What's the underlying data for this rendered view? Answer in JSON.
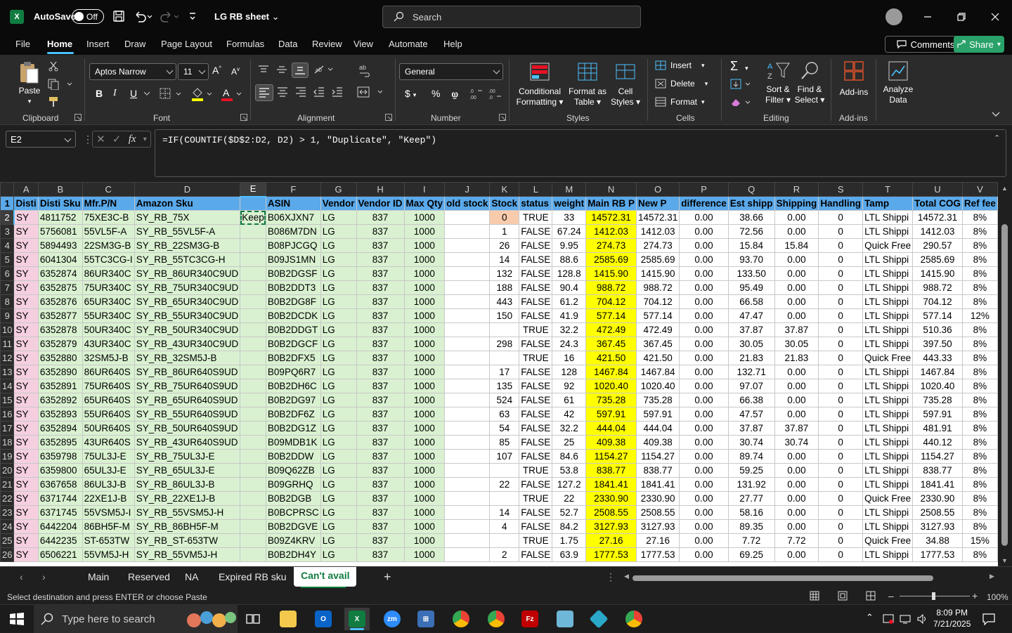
{
  "titlebar": {
    "autosave_label": "AutoSave",
    "toggle_state": "Off",
    "doc_title": "LG RB sheet",
    "search_placeholder": "Search"
  },
  "menu": {
    "items": [
      "File",
      "Home",
      "Insert",
      "Draw",
      "Page Layout",
      "Formulas",
      "Data",
      "Review",
      "View",
      "Automate",
      "Help"
    ],
    "active": "Home",
    "comments": "Comments",
    "share": "Share"
  },
  "ribbon": {
    "clipboard": {
      "label": "Clipboard",
      "paste": "Paste"
    },
    "font": {
      "label": "Font",
      "name": "Aptos Narrow",
      "size": "11",
      "bold": "B",
      "italic": "I",
      "underline": "U"
    },
    "alignment": {
      "label": "Alignment"
    },
    "number": {
      "label": "Number",
      "format": "General"
    },
    "styles": {
      "label": "Styles",
      "conditional": [
        "Conditional",
        "Formatting"
      ],
      "format_table": [
        "Format as",
        "Table"
      ],
      "cell_styles": [
        "Cell",
        "Styles"
      ]
    },
    "cells": {
      "label": "Cells",
      "insert": "Insert",
      "delete": "Delete",
      "format": "Format"
    },
    "editing": {
      "label": "Editing",
      "sort": [
        "Sort &",
        "Filter"
      ],
      "find": [
        "Find &",
        "Select"
      ]
    },
    "addins": {
      "label": "Add-ins",
      "addins": "Add-ins",
      "analyze": [
        "Analyze",
        "Data"
      ]
    }
  },
  "formula_bar": {
    "name_box": "E2",
    "formula": "=IF(COUNTIF($D$2:D2, D2) > 1, \"Duplicate\", \"Keep\")"
  },
  "columns": [
    "A",
    "B",
    "C",
    "D",
    "E",
    "F",
    "G",
    "H",
    "I",
    "J",
    "K",
    "L",
    "M",
    "N",
    "O",
    "P",
    "Q",
    "R",
    "S",
    "T",
    "U",
    "V"
  ],
  "header_row": [
    "Disti",
    "Disti Sku",
    "Mfr.P/N",
    "Amazon Sku",
    "",
    "ASIN",
    "Vendor",
    "Vendor ID",
    "Max Qty",
    "old stock",
    "Stock",
    "status",
    "weight",
    "Main RB P",
    "New P",
    "difference",
    "Est shipp",
    "Shipping",
    "Handling",
    "Tamp",
    "Total COG",
    "Ref fee"
  ],
  "rows": [
    [
      "SY",
      "4811752",
      "75XE3C-B",
      "SY_RB_75X",
      "Keep",
      "B06XJXN7",
      "LG",
      "837",
      "1000",
      "",
      "0",
      "TRUE",
      "33",
      "14572.31",
      "14572.31",
      "0.00",
      "38.66",
      "0.00",
      "0",
      "LTL Shippi",
      "14572.31",
      "8%"
    ],
    [
      "SY",
      "5756081",
      "55VL5F-A",
      "SY_RB_55VL5F-A",
      "",
      "B086M7DN",
      "LG",
      "837",
      "1000",
      "",
      "1",
      "FALSE",
      "67.24",
      "1412.03",
      "1412.03",
      "0.00",
      "72.56",
      "0.00",
      "0",
      "LTL Shippi",
      "1412.03",
      "8%"
    ],
    [
      "SY",
      "5894493",
      "22SM3G-B",
      "SY_RB_22SM3G-B",
      "",
      "B08PJCGQ",
      "LG",
      "837",
      "1000",
      "",
      "26",
      "FALSE",
      "9.95",
      "274.73",
      "274.73",
      "0.00",
      "15.84",
      "15.84",
      "0",
      "Quick Free",
      "290.57",
      "8%"
    ],
    [
      "SY",
      "6041304",
      "55TC3CG-I",
      "SY_RB_55TC3CG-H",
      "",
      "B09JS1MN",
      "LG",
      "837",
      "1000",
      "",
      "14",
      "FALSE",
      "88.6",
      "2585.69",
      "2585.69",
      "0.00",
      "93.70",
      "0.00",
      "0",
      "LTL Shippi",
      "2585.69",
      "8%"
    ],
    [
      "SY",
      "6352874",
      "86UR340C",
      "SY_RB_86UR340C9UD",
      "",
      "B0B2DGSF",
      "LG",
      "837",
      "1000",
      "",
      "132",
      "FALSE",
      "128.8",
      "1415.90",
      "1415.90",
      "0.00",
      "133.50",
      "0.00",
      "0",
      "LTL Shippi",
      "1415.90",
      "8%"
    ],
    [
      "SY",
      "6352875",
      "75UR340C",
      "SY_RB_75UR340C9UD",
      "",
      "B0B2DDT3",
      "LG",
      "837",
      "1000",
      "",
      "188",
      "FALSE",
      "90.4",
      "988.72",
      "988.72",
      "0.00",
      "95.49",
      "0.00",
      "0",
      "LTL Shippi",
      "988.72",
      "8%"
    ],
    [
      "SY",
      "6352876",
      "65UR340C",
      "SY_RB_65UR340C9UD",
      "",
      "B0B2DG8F",
      "LG",
      "837",
      "1000",
      "",
      "443",
      "FALSE",
      "61.2",
      "704.12",
      "704.12",
      "0.00",
      "66.58",
      "0.00",
      "0",
      "LTL Shippi",
      "704.12",
      "8%"
    ],
    [
      "SY",
      "6352877",
      "55UR340C",
      "SY_RB_55UR340C9UD",
      "",
      "B0B2DCDK",
      "LG",
      "837",
      "1000",
      "",
      "150",
      "FALSE",
      "41.9",
      "577.14",
      "577.14",
      "0.00",
      "47.47",
      "0.00",
      "0",
      "LTL Shippi",
      "577.14",
      "12%"
    ],
    [
      "SY",
      "6352878",
      "50UR340C",
      "SY_RB_50UR340C9UD",
      "",
      "B0B2DDGT",
      "LG",
      "837",
      "1000",
      "",
      "",
      "TRUE",
      "32.2",
      "472.49",
      "472.49",
      "0.00",
      "37.87",
      "37.87",
      "0",
      "LTL Shippi",
      "510.36",
      "8%"
    ],
    [
      "SY",
      "6352879",
      "43UR340C",
      "SY_RB_43UR340C9UD",
      "",
      "B0B2DGCF",
      "LG",
      "837",
      "1000",
      "",
      "298",
      "FALSE",
      "24.3",
      "367.45",
      "367.45",
      "0.00",
      "30.05",
      "30.05",
      "0",
      "LTL Shippi",
      "397.50",
      "8%"
    ],
    [
      "SY",
      "6352880",
      "32SM5J-B",
      "SY_RB_32SM5J-B",
      "",
      "B0B2DFX5",
      "LG",
      "837",
      "1000",
      "",
      "",
      "TRUE",
      "16",
      "421.50",
      "421.50",
      "0.00",
      "21.83",
      "21.83",
      "0",
      "Quick Free",
      "443.33",
      "8%"
    ],
    [
      "SY",
      "6352890",
      "86UR640S",
      "SY_RB_86UR640S9UD",
      "",
      "B09PQ6R7",
      "LG",
      "837",
      "1000",
      "",
      "17",
      "FALSE",
      "128",
      "1467.84",
      "1467.84",
      "0.00",
      "132.71",
      "0.00",
      "0",
      "LTL Shippi",
      "1467.84",
      "8%"
    ],
    [
      "SY",
      "6352891",
      "75UR640S",
      "SY_RB_75UR640S9UD",
      "",
      "B0B2DH6C",
      "LG",
      "837",
      "1000",
      "",
      "135",
      "FALSE",
      "92",
      "1020.40",
      "1020.40",
      "0.00",
      "97.07",
      "0.00",
      "0",
      "LTL Shippi",
      "1020.40",
      "8%"
    ],
    [
      "SY",
      "6352892",
      "65UR640S",
      "SY_RB_65UR640S9UD",
      "",
      "B0B2DG97",
      "LG",
      "837",
      "1000",
      "",
      "524",
      "FALSE",
      "61",
      "735.28",
      "735.28",
      "0.00",
      "66.38",
      "0.00",
      "0",
      "LTL Shippi",
      "735.28",
      "8%"
    ],
    [
      "SY",
      "6352893",
      "55UR640S",
      "SY_RB_55UR640S9UD",
      "",
      "B0B2DF6Z",
      "LG",
      "837",
      "1000",
      "",
      "63",
      "FALSE",
      "42",
      "597.91",
      "597.91",
      "0.00",
      "47.57",
      "0.00",
      "0",
      "LTL Shippi",
      "597.91",
      "8%"
    ],
    [
      "SY",
      "6352894",
      "50UR640S",
      "SY_RB_50UR640S9UD",
      "",
      "B0B2DG1Z",
      "LG",
      "837",
      "1000",
      "",
      "54",
      "FALSE",
      "32.2",
      "444.04",
      "444.04",
      "0.00",
      "37.87",
      "37.87",
      "0",
      "LTL Shippi",
      "481.91",
      "8%"
    ],
    [
      "SY",
      "6352895",
      "43UR640S",
      "SY_RB_43UR640S9UD",
      "",
      "B09MDB1K",
      "LG",
      "837",
      "1000",
      "",
      "85",
      "FALSE",
      "25",
      "409.38",
      "409.38",
      "0.00",
      "30.74",
      "30.74",
      "0",
      "LTL Shippi",
      "440.12",
      "8%"
    ],
    [
      "SY",
      "6359798",
      "75UL3J-E",
      "SY_RB_75UL3J-E",
      "",
      "B0B2DDW",
      "LG",
      "837",
      "1000",
      "",
      "107",
      "FALSE",
      "84.6",
      "1154.27",
      "1154.27",
      "0.00",
      "89.74",
      "0.00",
      "0",
      "LTL Shippi",
      "1154.27",
      "8%"
    ],
    [
      "SY",
      "6359800",
      "65UL3J-E",
      "SY_RB_65UL3J-E",
      "",
      "B09Q62ZB",
      "LG",
      "837",
      "1000",
      "",
      "",
      "TRUE",
      "53.8",
      "838.77",
      "838.77",
      "0.00",
      "59.25",
      "0.00",
      "0",
      "LTL Shippi",
      "838.77",
      "8%"
    ],
    [
      "SY",
      "6367658",
      "86UL3J-B",
      "SY_RB_86UL3J-B",
      "",
      "B09GRHQ",
      "LG",
      "837",
      "1000",
      "",
      "22",
      "FALSE",
      "127.2",
      "1841.41",
      "1841.41",
      "0.00",
      "131.92",
      "0.00",
      "0",
      "LTL Shippi",
      "1841.41",
      "8%"
    ],
    [
      "SY",
      "6371744",
      "22XE1J-B",
      "SY_RB_22XE1J-B",
      "",
      "B0B2DGB",
      "LG",
      "837",
      "1000",
      "",
      "",
      "TRUE",
      "22",
      "2330.90",
      "2330.90",
      "0.00",
      "27.77",
      "0.00",
      "0",
      "Quick Free",
      "2330.90",
      "8%"
    ],
    [
      "SY",
      "6371745",
      "55VSM5J-I",
      "SY_RB_55VSM5J-H",
      "",
      "B0BCPRSC",
      "LG",
      "837",
      "1000",
      "",
      "14",
      "FALSE",
      "52.7",
      "2508.55",
      "2508.55",
      "0.00",
      "58.16",
      "0.00",
      "0",
      "LTL Shippi",
      "2508.55",
      "8%"
    ],
    [
      "SY",
      "6442204",
      "86BH5F-M",
      "SY_RB_86BH5F-M",
      "",
      "B0B2DGVE",
      "LG",
      "837",
      "1000",
      "",
      "4",
      "FALSE",
      "84.2",
      "3127.93",
      "3127.93",
      "0.00",
      "89.35",
      "0.00",
      "0",
      "LTL Shippi",
      "3127.93",
      "8%"
    ],
    [
      "SY",
      "6442235",
      "ST-653TW",
      "SY_RB_ST-653TW",
      "",
      "B09Z4KRV",
      "LG",
      "837",
      "1000",
      "",
      "",
      "TRUE",
      "1.75",
      "27.16",
      "27.16",
      "0.00",
      "7.72",
      "7.72",
      "0",
      "Quick Free",
      "34.88",
      "15%"
    ],
    [
      "SY",
      "6506221",
      "55VM5J-H",
      "SY_RB_55VM5J-H",
      "",
      "B0B2DH4Y",
      "LG",
      "837",
      "1000",
      "",
      "2",
      "FALSE",
      "63.9",
      "1777.53",
      "1777.53",
      "0.00",
      "69.25",
      "0.00",
      "0",
      "LTL Shippi",
      "1777.53",
      "8%"
    ]
  ],
  "sheets": [
    "Main",
    "Reserved",
    "NA",
    "Expired RB sku",
    "Can't avail"
  ],
  "active_sheet": "Can't avail",
  "status": {
    "message": "Select destination and press ENTER or choose Paste",
    "zoom": "100%"
  },
  "taskbar": {
    "search_placeholder": "Type here to search",
    "time": "8:09 PM",
    "date": "7/21/2025"
  }
}
